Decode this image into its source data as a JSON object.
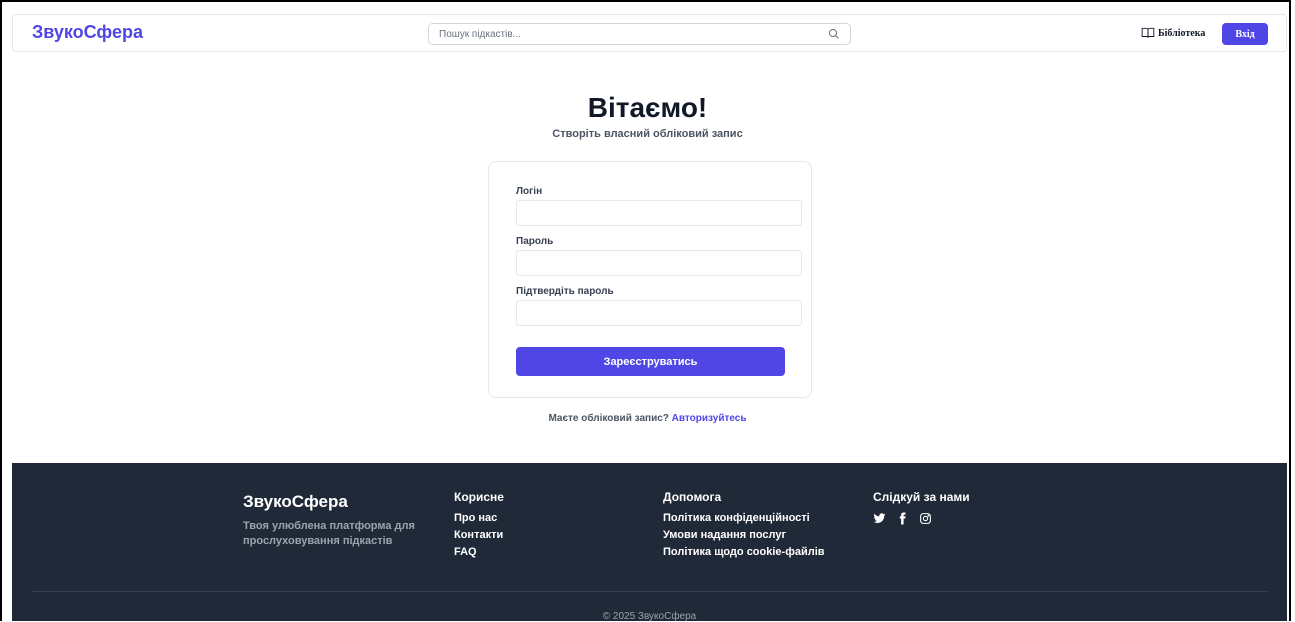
{
  "header": {
    "logo": "ЗвукоСфера",
    "search_placeholder": "Пошук підкастів...",
    "library_label": "Бібліотека",
    "login_label": "Вхід"
  },
  "main": {
    "title": "Вітаємо!",
    "subtitle": "Створіть власний обліковий запис",
    "form": {
      "login_label": "Логін",
      "password_label": "Пароль",
      "confirm_label": "Підтвердіть пароль",
      "submit_label": "Зареєструватись"
    },
    "have_account_text": "Маєте обліковий запис?",
    "auth_link": "Авторизуйтесь"
  },
  "footer": {
    "brand": "ЗвукоСфера",
    "tagline": "Твоя улюблена платформа для прослуховування підкастів",
    "useful": {
      "heading": "Корисне",
      "links": [
        "Про нас",
        "Контакти",
        "FAQ"
      ]
    },
    "help": {
      "heading": "Допомога",
      "links": [
        "Політика конфіденційності",
        "Умови надання послуг",
        "Політика щодо cookie-файлів"
      ]
    },
    "follow": {
      "heading": "Слідкуй за нами",
      "icons": [
        "twitter-icon",
        "facebook-icon",
        "instagram-icon"
      ]
    },
    "copyright": "© 2025 ЗвукоСфера"
  },
  "colors": {
    "accent": "#4f46e5",
    "footer_bg": "#1f2937"
  }
}
